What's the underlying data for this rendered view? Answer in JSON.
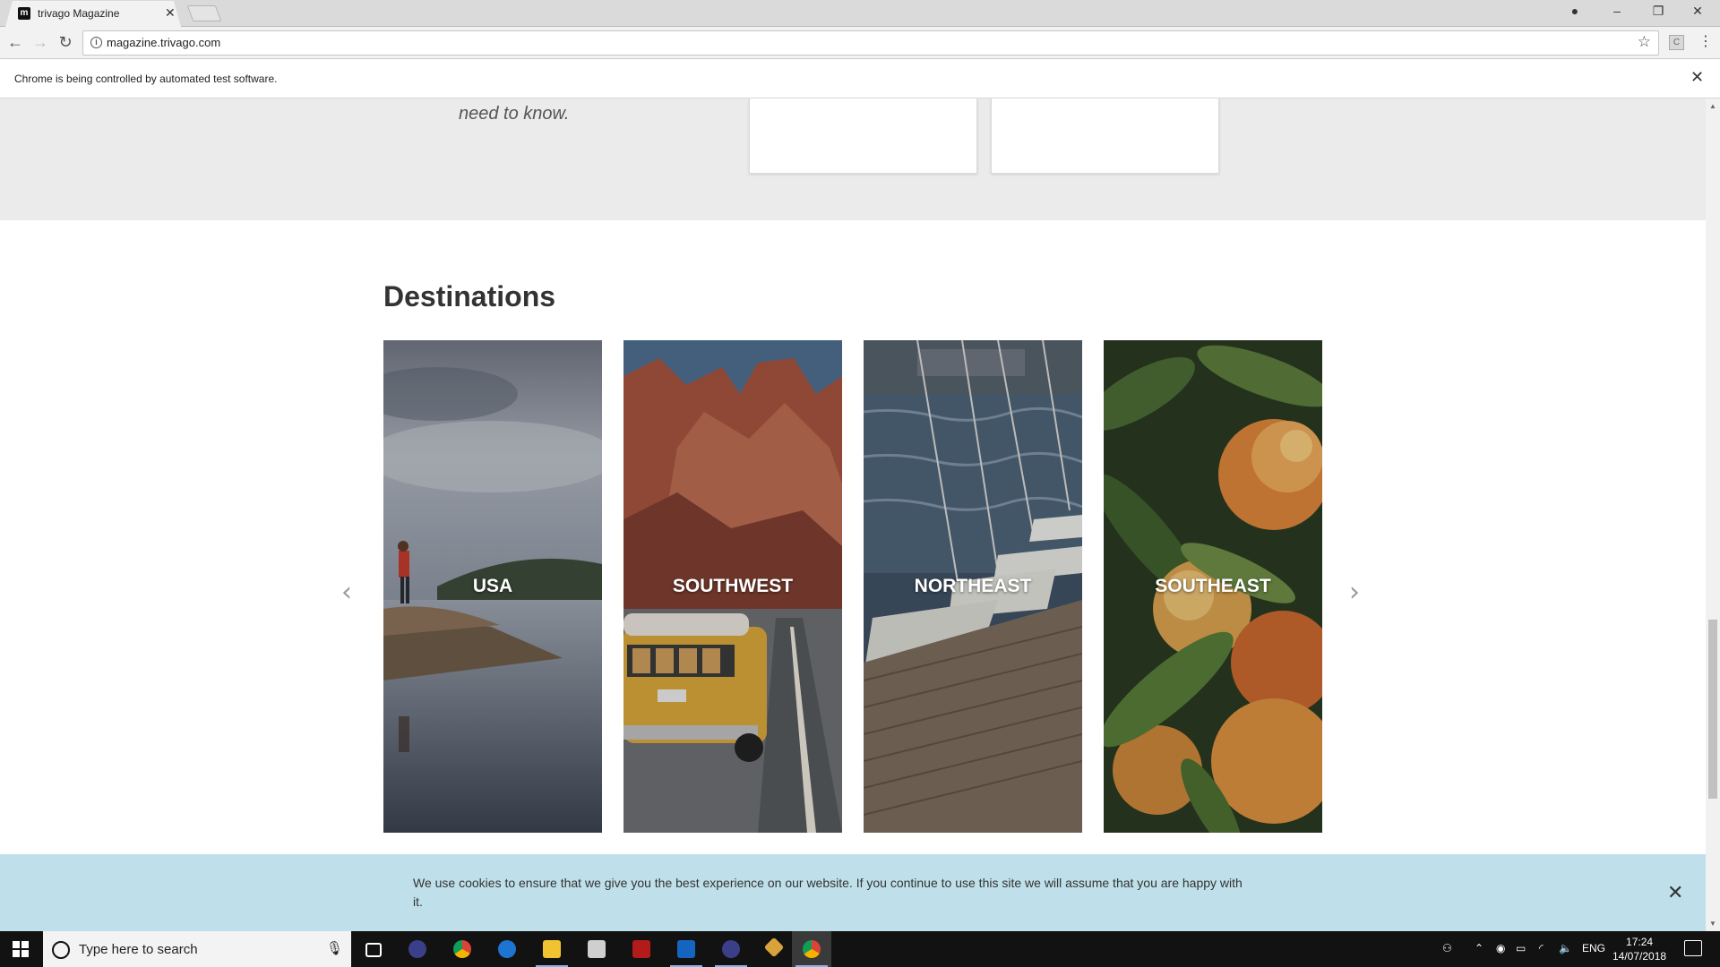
{
  "browser": {
    "tab_title": "trivago Magazine",
    "tab_close": "✕",
    "favicon_letter": "m",
    "url": "magazine.trivago.com",
    "infobar_text": "Chrome is being controlled by automated test software.",
    "infobar_close": "✕"
  },
  "page": {
    "intro_tail": "need to know.",
    "section_title": "Destinations",
    "destinations": [
      {
        "label": "USA"
      },
      {
        "label": "SOUTHWEST"
      },
      {
        "label": "NORTHEAST"
      },
      {
        "label": "SOUTHEAST"
      }
    ],
    "prev_arrow": "‹",
    "next_arrow": "›"
  },
  "cookie": {
    "text": "We use cookies to ensure that we give you the best experience on our website. If you continue to use this site we will assume that you are happy with it.",
    "close": "✕"
  },
  "taskbar": {
    "search_placeholder": "Type here to search",
    "language": "ENG",
    "time": "17:24",
    "date": "14/07/2018"
  },
  "colors": {
    "cookie_bg": "#bfe0ea",
    "gray_band": "#ebebeb",
    "taskbar": "#121212"
  }
}
